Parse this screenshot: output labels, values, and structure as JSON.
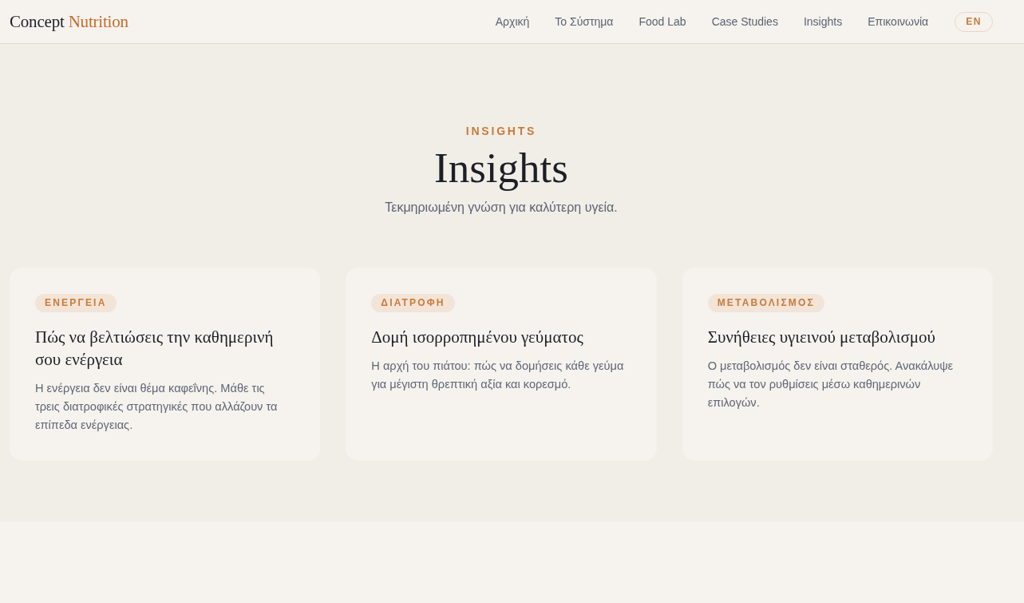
{
  "header": {
    "logo": {
      "primary": "Concept",
      "accent": "Nutrition"
    },
    "nav": [
      "Αρχική",
      "Το Σύστημα",
      "Food Lab",
      "Case Studies",
      "Insights",
      "Επικοινωνία"
    ],
    "language_button": "EN"
  },
  "hero": {
    "eyebrow": "INSIGHTS",
    "title": "Insights",
    "subtitle": "Τεκμηριωμένη γνώση για καλύτερη υγεία."
  },
  "articles": [
    {
      "tag": "ΕΝΕΡΓΕΙΑ",
      "title": "Πώς να βελτιώσεις την καθημερινή σου ενέργεια",
      "summary": "Η ενέργεια δεν είναι θέμα καφεΐνης. Μάθε τις τρεις διατροφικές στρατηγικές που αλλάζουν τα επίπεδα ενέργειας."
    },
    {
      "tag": "ΔΙΑΤΡΟΦΗ",
      "title": "Δομή ισορροπημένου γεύματος",
      "summary": "Η αρχή του πιάτου: πώς να δομήσεις κάθε γεύμα για μέγιστη θρεπτική αξία και κορεσμό."
    },
    {
      "tag": "ΜΕΤΑΒΟΛΙΣΜΟΣ",
      "title": "Συνήθειες υγιεινού μεταβολισμού",
      "summary": "Ο μεταβολισμός δεν είναι σταθερός. Ανακάλυψε πώς να τον ρυθμίσεις μέσω καθημερινών επιλογών."
    }
  ]
}
